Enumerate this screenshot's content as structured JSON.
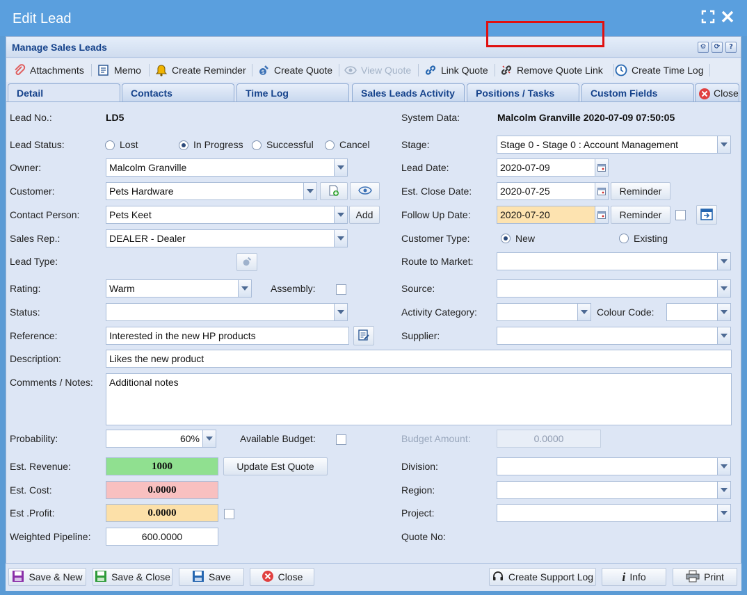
{
  "window": {
    "title": "Edit Lead"
  },
  "panel": {
    "title": "Manage Sales Leads"
  },
  "toolbar": {
    "attachments": "Attachments",
    "memo": "Memo",
    "create_reminder": "Create Reminder",
    "create_quote": "Create Quote",
    "view_quote": "View Quote",
    "link_quote": "Link Quote",
    "remove_quote_link": "Remove Quote Link",
    "create_time_log": "Create Time Log"
  },
  "tabs": [
    "Detail",
    "Contacts",
    "Time Log",
    "Sales Leads Activity",
    "Positions / Tasks",
    "Custom Fields"
  ],
  "close_tab": "Close",
  "form": {
    "lead_no": {
      "label": "Lead No.:",
      "value": "LD5"
    },
    "system_data": {
      "label": "System Data:",
      "value": "Malcolm Granville 2020-07-09 07:50:05"
    },
    "lead_status": {
      "label": "Lead Status:",
      "options": [
        "Lost",
        "In Progress",
        "Successful",
        "Cancel"
      ],
      "selected": "In Progress"
    },
    "stage": {
      "label": "Stage:",
      "value": "Stage 0 - Stage 0 : Account Management"
    },
    "owner": {
      "label": "Owner:",
      "value": "Malcolm Granville"
    },
    "lead_date": {
      "label": "Lead Date:",
      "value": "2020-07-09"
    },
    "customer": {
      "label": "Customer:",
      "value": "Pets Hardware"
    },
    "est_close_date": {
      "label": "Est. Close Date:",
      "value": "2020-07-25"
    },
    "reminder_label": "Reminder",
    "contact_person": {
      "label": "Contact Person:",
      "value": "Pets Keet",
      "add": "Add"
    },
    "follow_up_date": {
      "label": "Follow Up Date:",
      "value": "2020-07-20"
    },
    "sales_rep": {
      "label": "Sales Rep.:",
      "value": "DEALER - Dealer"
    },
    "customer_type": {
      "label": "Customer Type:",
      "options": [
        "New",
        "Existing"
      ],
      "selected": "New"
    },
    "lead_type": {
      "label": "Lead Type:"
    },
    "route_to_market": {
      "label": "Route to Market:",
      "value": ""
    },
    "rating": {
      "label": "Rating:",
      "value": "Warm"
    },
    "assembly": {
      "label": "Assembly:"
    },
    "source": {
      "label": "Source:",
      "value": ""
    },
    "status": {
      "label": "Status:",
      "value": ""
    },
    "activity_category": {
      "label": "Activity Category:",
      "value": ""
    },
    "colour_code": {
      "label": "Colour Code:",
      "value": ""
    },
    "reference": {
      "label": "Reference:",
      "value": "Interested in the new HP products"
    },
    "supplier": {
      "label": "Supplier:",
      "value": ""
    },
    "description": {
      "label": "Description:",
      "value": "Likes the new product"
    },
    "comments": {
      "label": "Comments / Notes:",
      "value": "Additional notes"
    },
    "probability": {
      "label": "Probability:",
      "value": "60%"
    },
    "available_budget": {
      "label": "Available Budget:"
    },
    "budget_amount": {
      "label": "Budget Amount:",
      "value": "0.0000"
    },
    "est_revenue": {
      "label": "Est. Revenue:",
      "value": "1000",
      "button": "Update Est Quote"
    },
    "division": {
      "label": "Division:",
      "value": ""
    },
    "est_cost": {
      "label": "Est. Cost:",
      "value": "0.0000"
    },
    "region": {
      "label": "Region:",
      "value": ""
    },
    "est_profit": {
      "label": "Est .Profit:",
      "value": "0.0000"
    },
    "project": {
      "label": "Project:",
      "value": ""
    },
    "weighted_pipeline": {
      "label": "Weighted Pipeline:",
      "value": "600.0000"
    },
    "quote_no": {
      "label": "Quote No:"
    }
  },
  "footer": {
    "save_new": "Save & New",
    "save_close": "Save & Close",
    "save": "Save",
    "close": "Close",
    "support_log": "Create Support Log",
    "info": "Info",
    "print": "Print"
  },
  "colors": {
    "revenue": "#90e090",
    "cost": "#f8c0c0",
    "profit": "#fce0a8",
    "follow_up": "#fde3b0",
    "highlight": "#e01010"
  }
}
